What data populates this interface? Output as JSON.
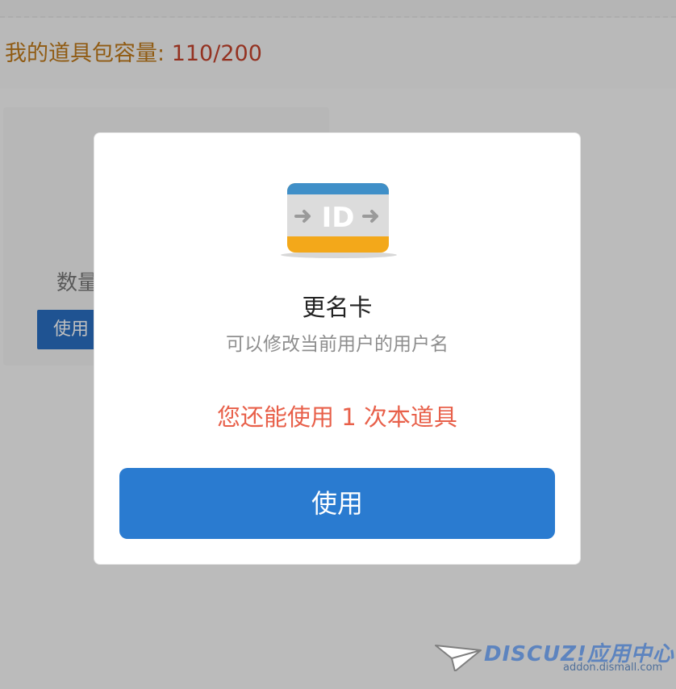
{
  "background": {
    "capacity_label": "我的道具包容量:",
    "capacity_value": "110/200",
    "item_quantity_label": "数量",
    "item_use_label": "使用"
  },
  "modal": {
    "icon": "id-card-icon",
    "icon_text": "ID",
    "title": "更名卡",
    "description": "可以修改当前用户的用户名",
    "remaining_text": "您还能使用 1 次本道具",
    "use_button_label": "使用"
  },
  "watermark": {
    "brand": "DISCUZ!应用中心",
    "url": "addon.dismall.com"
  },
  "colors": {
    "accent_blue": "#2a7bd0",
    "warning_red": "#e8604a",
    "capacity_orange": "#c07a1a"
  }
}
